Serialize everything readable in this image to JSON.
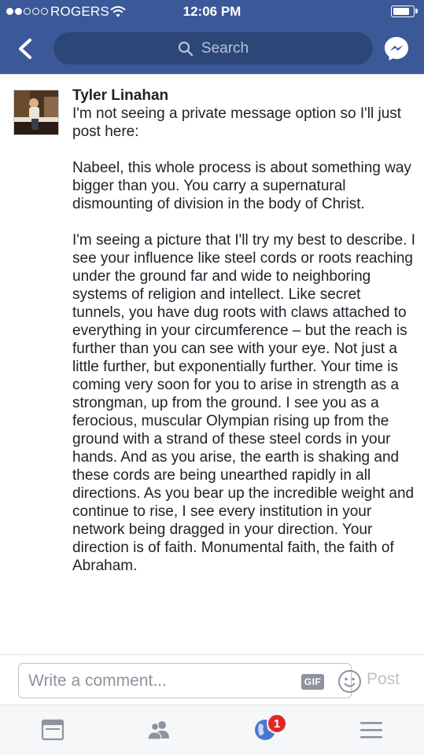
{
  "status_bar": {
    "carrier": "ROGERS",
    "time": "12:06 PM",
    "signal_bars_filled": 2,
    "signal_bars_total": 5,
    "battery_level": 0.85
  },
  "header": {
    "search_placeholder": "Search",
    "icons": [
      "chevron-left-icon",
      "search-icon",
      "messenger-icon"
    ]
  },
  "post": {
    "author": "Tyler Linahan",
    "paragraphs": [
      "I'm not seeing a private message option so I'll just post here:",
      "Nabeel, this whole process is about something way bigger than you. You carry a supernatural dismounting of division in the body of Christ.",
      "I'm seeing a picture that I'll try my best to describe.  I see your influence like steel cords or roots reaching under the ground far and wide to neighboring systems of religion and intellect. Like secret tunnels, you have dug roots with claws attached to everything in your circumference – but the reach is further than you can see with your eye. Not just a little further, but exponentially further. Your time is coming very soon for you to arise in strength as a strongman, up from the ground. I see you as a ferocious, muscular Olympian rising up from the ground with a strand of these steel cords in your hands. And as you arise, the earth is shaking and these cords are being unearthed rapidly in all directions. As you bear up the incredible weight and continue to rise, I see every institution in your network being dragged in your direction. Your direction is of faith. Monumental faith, the faith of Abraham."
    ]
  },
  "composer": {
    "placeholder": "Write a comment...",
    "gif_label": "GIF",
    "post_label": "Post"
  },
  "tabbar": {
    "tabs": [
      "news-feed-icon",
      "friends-icon",
      "notifications-globe-icon",
      "menu-icon"
    ],
    "notification_count": "1"
  },
  "colors": {
    "brand_blue": "#3b5998",
    "search_bg": "#2c4677",
    "badge_red": "#e02828",
    "text": "#1d2129",
    "muted": "#8d949e"
  }
}
